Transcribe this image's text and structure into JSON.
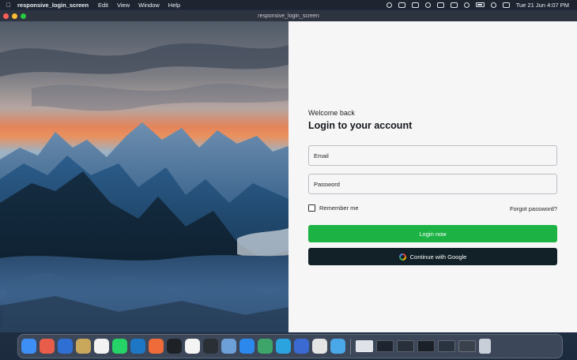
{
  "menubar": {
    "app_name": "responsive_login_screen",
    "menus": [
      "Edit",
      "View",
      "Window",
      "Help"
    ],
    "datetime": "Tue 21 Jun  4:07 PM",
    "status_icons": [
      "creative-cloud-icon",
      "camera-icon",
      "volume-icon",
      "bluetooth-icon",
      "keyboard-icon",
      "display-icon",
      "wifi-icon",
      "battery-icon",
      "search-icon",
      "control-center-icon"
    ]
  },
  "window": {
    "title": "responsive_login_screen"
  },
  "login": {
    "welcome": "Welcome back",
    "heading": "Login to your account",
    "email_label": "Email",
    "password_label": "Password",
    "remember_label": "Remember me",
    "forgot_label": "Forgot password?",
    "login_button": "Login now",
    "google_button": "Continue with Google",
    "colors": {
      "login_button": "#1db344",
      "google_button": "#122027",
      "field_border": "#b9bec6"
    }
  },
  "dock": {
    "apps": [
      {
        "name": "finder-icon",
        "color": "#3d8ff5"
      },
      {
        "name": "launchpad-icon",
        "color": "#e85d4a"
      },
      {
        "name": "safari-icon",
        "color": "#2f6fd3"
      },
      {
        "name": "photos-icon",
        "color": "#c9a85c"
      },
      {
        "name": "github-desktop-icon",
        "color": "#f2f2f2"
      },
      {
        "name": "whatsapp-icon",
        "color": "#25d366"
      },
      {
        "name": "vscode-icon",
        "color": "#1d77c4"
      },
      {
        "name": "postman-icon",
        "color": "#ef6b3a"
      },
      {
        "name": "terminal-icon",
        "color": "#1e2227"
      },
      {
        "name": "calendar-icon",
        "color": "#f4f4f4"
      },
      {
        "name": "iterm-icon",
        "color": "#2a2e35"
      },
      {
        "name": "disk-utility-icon",
        "color": "#6ea0d8"
      },
      {
        "name": "app-store-icon",
        "color": "#2d88ee"
      },
      {
        "name": "android-studio-icon",
        "color": "#3ea56a"
      },
      {
        "name": "telegram-icon",
        "color": "#2aa3df"
      },
      {
        "name": "xcode-icon",
        "color": "#3a6ad2"
      },
      {
        "name": "chrome-icon",
        "color": "#e4e4e4"
      },
      {
        "name": "flutter-icon",
        "color": "#4aa8e8"
      }
    ],
    "thumbnails": [
      "#dfe3e9",
      "#1e2530",
      "#27303b",
      "#1b2129",
      "#2a3440",
      "#39414c"
    ],
    "trash": "trash-icon"
  }
}
